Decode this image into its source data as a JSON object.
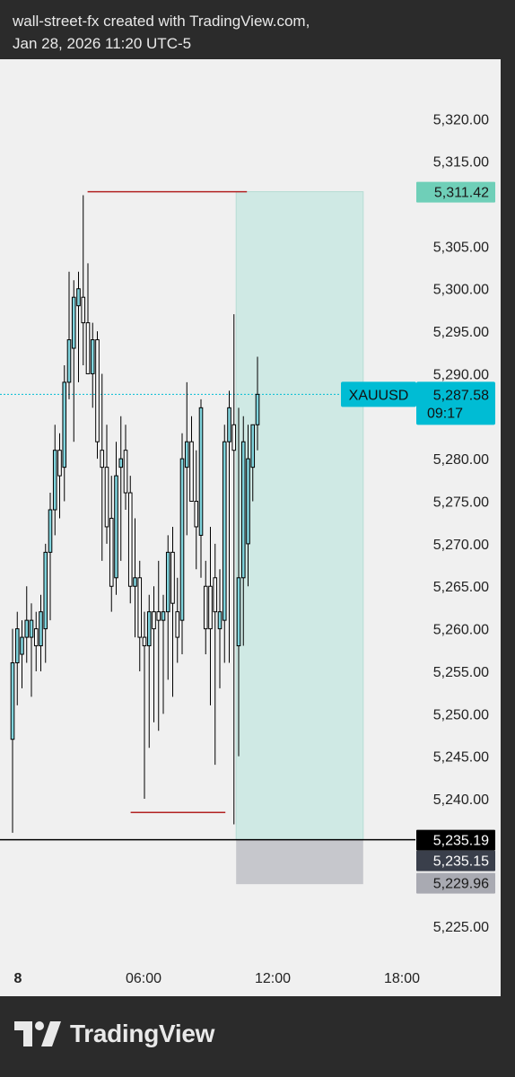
{
  "header": {
    "line1": "wall-street-fx created with TradingView.com,",
    "line2": "Jan 28, 2026 11:20 UTC-5"
  },
  "brand": {
    "name": "TradingView",
    "logo_icon": "tradingview-logo-icon"
  },
  "chart_data": {
    "type": "candlestick",
    "symbol": "XAUUSD",
    "y_ticks": [
      5320,
      5315,
      5305,
      5300,
      5295,
      5290,
      5280,
      5275,
      5270,
      5265,
      5260,
      5255,
      5250,
      5245,
      5240,
      5225
    ],
    "y_tick_labels": [
      "5,320.00",
      "5,315.00",
      "5,305.00",
      "5,300.00",
      "5,295.00",
      "5,290.00",
      "5,280.00",
      "5,275.00",
      "5,270.00",
      "5,265.00",
      "5,260.00",
      "5,255.00",
      "5,250.00",
      "5,245.00",
      "5,240.00",
      "5,225.00"
    ],
    "ylim": [
      5221,
      5327
    ],
    "x_ticks": [
      "8",
      "06:00",
      "12:00",
      "18:00"
    ],
    "x_tick_hours": [
      0,
      6,
      12,
      18
    ],
    "xlim_hours": [
      0,
      23.5
    ],
    "grid": false,
    "current_price": {
      "value": 5287.58,
      "label": "5,287.58",
      "countdown": "09:17",
      "color": "#00bcd4"
    },
    "price_tags": [
      {
        "value": 5311.42,
        "label": "5,311.42",
        "bg": "#6fcfb8",
        "fg": "#1a1a1a"
      },
      {
        "value": 5235.19,
        "label": "5,235.19",
        "bg": "#000000",
        "fg": "#ffffff"
      },
      {
        "value": 5235.15,
        "label": "5,235.15",
        "bg": "#3a3f4b",
        "fg": "#ffffff"
      },
      {
        "value": 5229.96,
        "label": "5,229.96",
        "bg": "#a9aab2",
        "fg": "#1a1a1a"
      }
    ],
    "position_tool": {
      "type": "long",
      "start_hour": 10.3,
      "end_hour": 16.2,
      "entry": 5235.19,
      "target": 5311.42,
      "stop": 5229.96,
      "profit_color": "#cfe9e4",
      "loss_color": "#c6c7cc"
    },
    "horizontal_lines": [
      {
        "value": 5235.19,
        "color": "#000000"
      }
    ],
    "level_segments": [
      {
        "value": 5311.42,
        "from_hour": 3.4,
        "to_hour": 10.8,
        "color": "#b22222"
      },
      {
        "value": 5238.4,
        "from_hour": 5.4,
        "to_hour": 9.8,
        "color": "#b22222"
      }
    ],
    "candles": [
      {
        "o": 5247,
        "h": 5260,
        "l": 5236,
        "c": 5256
      },
      {
        "o": 5256,
        "h": 5262,
        "l": 5251,
        "c": 5260
      },
      {
        "o": 5257,
        "h": 5261,
        "l": 5253,
        "c": 5259
      },
      {
        "o": 5259,
        "h": 5265,
        "l": 5256,
        "c": 5261
      },
      {
        "o": 5259,
        "h": 5263,
        "l": 5252,
        "c": 5261
      },
      {
        "o": 5260,
        "h": 5262,
        "l": 5255,
        "c": 5258
      },
      {
        "o": 5258,
        "h": 5264,
        "l": 5255,
        "c": 5262
      },
      {
        "o": 5260,
        "h": 5270,
        "l": 5256,
        "c": 5269
      },
      {
        "o": 5269,
        "h": 5276,
        "l": 5261,
        "c": 5274
      },
      {
        "o": 5274,
        "h": 5284,
        "l": 5271,
        "c": 5281
      },
      {
        "o": 5281,
        "h": 5283,
        "l": 5273,
        "c": 5278
      },
      {
        "o": 5279,
        "h": 5291,
        "l": 5275,
        "c": 5289
      },
      {
        "o": 5289,
        "h": 5302,
        "l": 5287,
        "c": 5294
      },
      {
        "o": 5293,
        "h": 5301,
        "l": 5282,
        "c": 5299
      },
      {
        "o": 5298,
        "h": 5302,
        "l": 5289,
        "c": 5300
      },
      {
        "o": 5299,
        "h": 5311,
        "l": 5291,
        "c": 5296
      },
      {
        "o": 5296,
        "h": 5303,
        "l": 5290,
        "c": 5290
      },
      {
        "o": 5290,
        "h": 5296,
        "l": 5286,
        "c": 5294
      },
      {
        "o": 5294,
        "h": 5295,
        "l": 5280,
        "c": 5282
      },
      {
        "o": 5281,
        "h": 5290,
        "l": 5268,
        "c": 5279
      },
      {
        "o": 5279,
        "h": 5284,
        "l": 5270,
        "c": 5272
      },
      {
        "o": 5273,
        "h": 5278,
        "l": 5262,
        "c": 5265
      },
      {
        "o": 5266,
        "h": 5282,
        "l": 5264,
        "c": 5278
      },
      {
        "o": 5279,
        "h": 5285,
        "l": 5268,
        "c": 5280
      },
      {
        "o": 5281,
        "h": 5284,
        "l": 5274,
        "c": 5276
      },
      {
        "o": 5276,
        "h": 5278,
        "l": 5263,
        "c": 5265
      },
      {
        "o": 5265,
        "h": 5273,
        "l": 5259,
        "c": 5266
      },
      {
        "o": 5266,
        "h": 5268,
        "l": 5255,
        "c": 5259
      },
      {
        "o": 5259,
        "h": 5262,
        "l": 5240,
        "c": 5258
      },
      {
        "o": 5258,
        "h": 5264,
        "l": 5246,
        "c": 5262
      },
      {
        "o": 5262,
        "h": 5265,
        "l": 5249,
        "c": 5260
      },
      {
        "o": 5262,
        "h": 5268,
        "l": 5248,
        "c": 5261
      },
      {
        "o": 5261,
        "h": 5264,
        "l": 5250,
        "c": 5262
      },
      {
        "o": 5262,
        "h": 5271,
        "l": 5254,
        "c": 5269
      },
      {
        "o": 5269,
        "h": 5272,
        "l": 5252,
        "c": 5263
      },
      {
        "o": 5262,
        "h": 5266,
        "l": 5256,
        "c": 5259
      },
      {
        "o": 5261,
        "h": 5283,
        "l": 5257,
        "c": 5280
      },
      {
        "o": 5279,
        "h": 5289,
        "l": 5271,
        "c": 5282
      },
      {
        "o": 5282,
        "h": 5285,
        "l": 5275,
        "c": 5275
      },
      {
        "o": 5275,
        "h": 5281,
        "l": 5267,
        "c": 5272
      },
      {
        "o": 5271,
        "h": 5287,
        "l": 5266,
        "c": 5286
      },
      {
        "o": 5265,
        "h": 5268,
        "l": 5257,
        "c": 5260
      },
      {
        "o": 5265,
        "h": 5272,
        "l": 5251,
        "c": 5260
      },
      {
        "o": 5266,
        "h": 5270,
        "l": 5244,
        "c": 5262
      },
      {
        "o": 5260,
        "h": 5267,
        "l": 5253,
        "c": 5262
      },
      {
        "o": 5261,
        "h": 5284,
        "l": 5256,
        "c": 5282
      },
      {
        "o": 5282,
        "h": 5288,
        "l": 5256,
        "c": 5286
      },
      {
        "o": 5284,
        "h": 5297,
        "l": 5237,
        "c": 5281
      },
      {
        "o": 5258,
        "h": 5286,
        "l": 5245,
        "c": 5266
      },
      {
        "o": 5266,
        "h": 5285,
        "l": 5258,
        "c": 5282
      },
      {
        "o": 5270,
        "h": 5284,
        "l": 5265,
        "c": 5280
      },
      {
        "o": 5279,
        "h": 5284,
        "l": 5275,
        "c": 5284
      },
      {
        "o": 5284,
        "h": 5292,
        "l": 5281,
        "c": 5287.58
      }
    ]
  }
}
